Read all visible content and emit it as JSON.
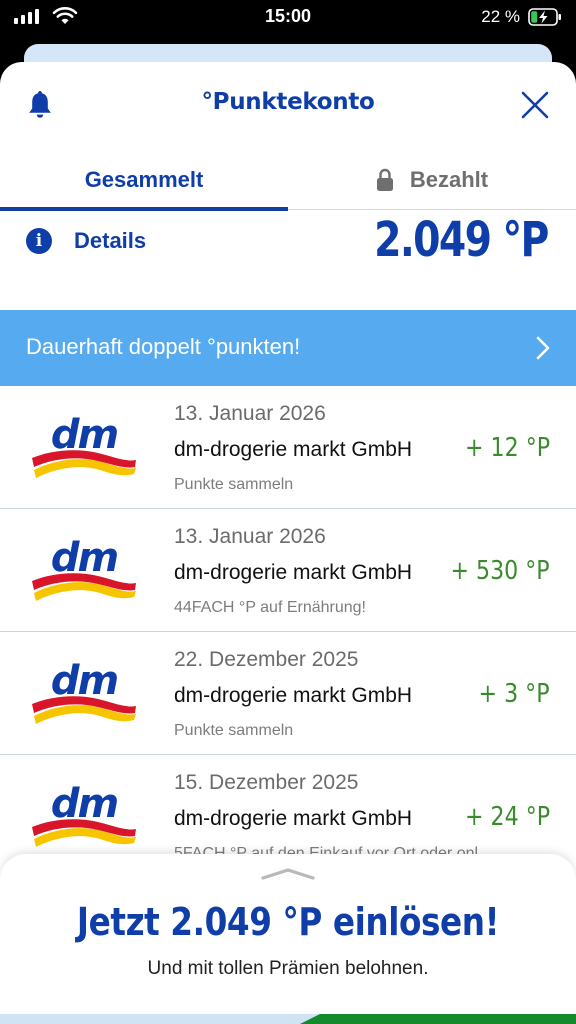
{
  "status_bar": {
    "time": "15:00",
    "battery_percent": "22 %"
  },
  "header": {
    "title": "°Punktekonto"
  },
  "tabs": [
    {
      "label": "Gesammelt",
      "active": true
    },
    {
      "label": "Bezahlt",
      "active": false
    }
  ],
  "details": {
    "label": "Details",
    "points_total": "2.049 °P"
  },
  "promo": {
    "label": "Dauerhaft doppelt °punkten!"
  },
  "transactions": [
    {
      "date": "13. Januar 2026",
      "merchant": "dm-drogerie markt GmbH",
      "points": "+ 12 °P",
      "note": "Punkte sammeln",
      "logo": "dm"
    },
    {
      "date": "13. Januar 2026",
      "merchant": "dm-drogerie markt GmbH",
      "points": "+ 530 °P",
      "note": "44FACH °P auf Ernährung!",
      "logo": "dm"
    },
    {
      "date": "22. Dezember 2025",
      "merchant": "dm-drogerie markt GmbH",
      "points": "+ 3 °P",
      "note": "Punkte sammeln",
      "logo": "dm"
    },
    {
      "date": "15. Dezember 2025",
      "merchant": "dm-drogerie markt GmbH",
      "points": "+ 24 °P",
      "note": "5FACH °P auf den Einkauf vor Ort oder onl",
      "logo": "dm"
    }
  ],
  "redeem": {
    "title": "Jetzt 2.049 °P einlösen!",
    "subtitle": "Und mit tollen Prämien belohnen."
  },
  "colors": {
    "brand_blue": "#0f3ea8",
    "promo_blue": "#56aaf0",
    "points_green": "#3a8b2e",
    "dm_red": "#d8152b",
    "dm_yellow": "#f7c400"
  },
  "icons": {
    "bell": "bell-icon",
    "close": "close-icon",
    "lock": "lock-icon",
    "info": "info-icon",
    "chevron": "chevron-right-icon",
    "handle": "chevron-up-handle"
  }
}
